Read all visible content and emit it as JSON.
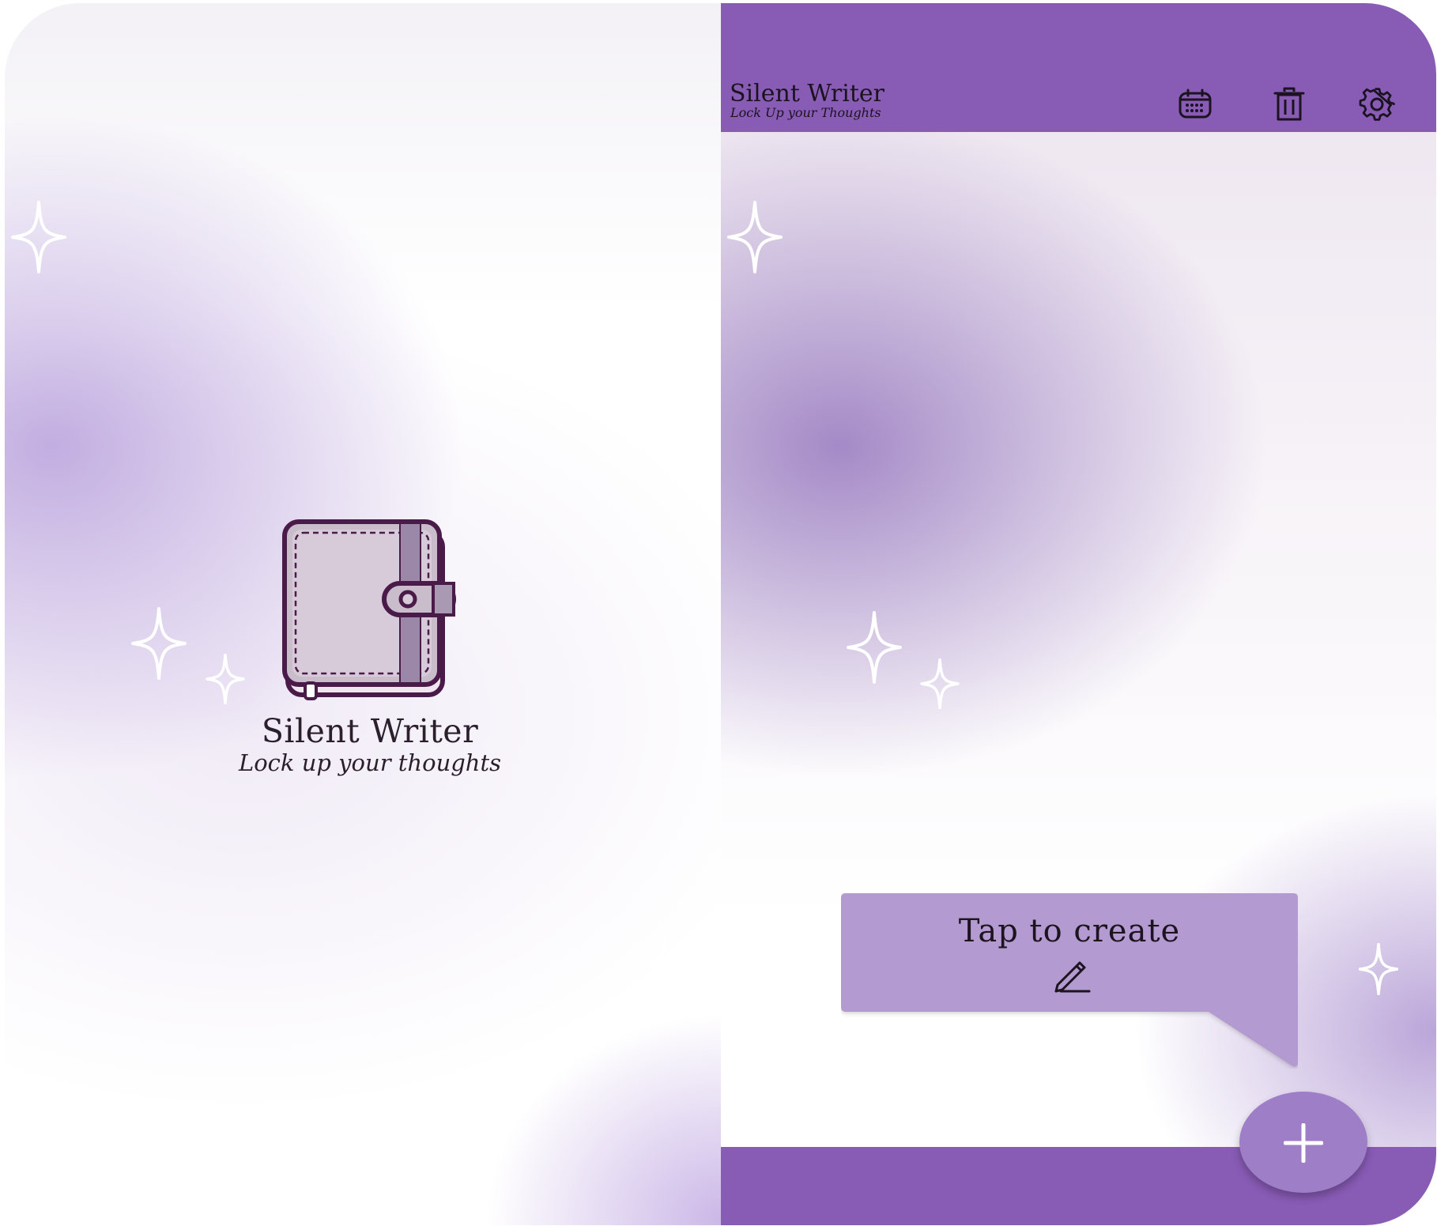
{
  "splash": {
    "title": "Silent Writer",
    "tagline": "Lock up your thoughts",
    "logo_icon": "journal-clasp-icon",
    "sparkle_icon": "sparkle-icon"
  },
  "app": {
    "header": {
      "title": "Silent Writer",
      "subtitle": "Lock Up your Thoughts",
      "actions": [
        {
          "icon": "calendar-icon"
        },
        {
          "icon": "trash-icon"
        },
        {
          "icon": "gear-icon"
        }
      ]
    },
    "empty_state": {
      "prompt": "Tap to create",
      "icon": "pen-icon"
    },
    "fab": {
      "icon": "plus-icon"
    }
  },
  "colors": {
    "brand_purple": "#885bb5",
    "tooltip_purple": "#b39ad0",
    "fab_purple": "#9e7ec7",
    "text_dark": "#2b1f2e"
  }
}
